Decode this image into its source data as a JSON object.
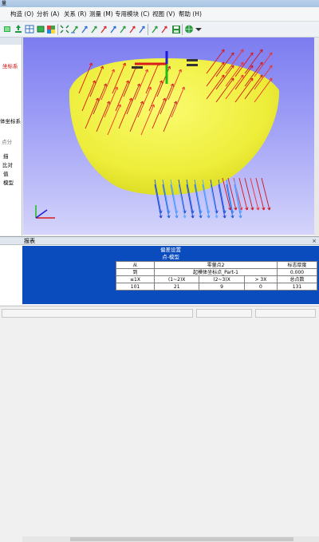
{
  "titlebar": {
    "text": "量"
  },
  "menu": {
    "items": [
      "",
      "构造 (O)",
      "分析 (A)",
      "关系 (R)",
      "测量 (M)",
      "专用模块 (C)",
      "视图 (V)",
      "帮助 (H)"
    ]
  },
  "toolbar": {
    "icons": [
      "green-cube-icon",
      "green-pan-icon",
      "grid-icon",
      "green-box-icon",
      "color-cube-icon",
      "zoom-fit-icon",
      "arrow-up-icon",
      "arrow-up-icon",
      "arrow-up-icon",
      "arrow-up-icon",
      "arrow-up-icon",
      "arrow-up-icon",
      "arrow-up-icon",
      "arrow-up-icon",
      "arrow-up-icon",
      "arrow-up-icon",
      "save-icon",
      "globe-icon",
      "dropdown-icon"
    ]
  },
  "tree": {
    "items": [
      {
        "text": "坐标系",
        "color": "#d01010"
      },
      {
        "text": "体坐标系",
        "color": "#000000"
      },
      {
        "text": "点分",
        "color": "#777777"
      },
      {
        "text": "描",
        "color": "#000000"
      },
      {
        "text": "比对",
        "color": "#000000"
      },
      {
        "text": "值",
        "color": "#000000"
      },
      {
        "text": "模型",
        "color": "#000000"
      }
    ]
  },
  "viewport": {
    "background_top": "#7c7cf0",
    "background_bottom": "#d4d4fb",
    "shape_color": "#f0f040",
    "axes": {
      "x": "#d81b1b",
      "y": "#1bbf1b",
      "z": "#1b1bd8"
    }
  },
  "report": {
    "panel_title": "报表",
    "close_label": "×",
    "header_title": "偏差设置",
    "sub_title": "点-模型",
    "table": {
      "row1": {
        "col0": "从",
        "col1": "零量点2",
        "col2": "标志厚度"
      },
      "row2": {
        "col0": "到",
        "col1": "起模体坐标点_Part-1",
        "col2": "0.000"
      },
      "row3": [
        "≤1X",
        "(1~2)X",
        "(2~3)X",
        "> 3X",
        "总点数"
      ],
      "row4": [
        "101",
        "21",
        "9",
        "0",
        "131"
      ]
    }
  }
}
